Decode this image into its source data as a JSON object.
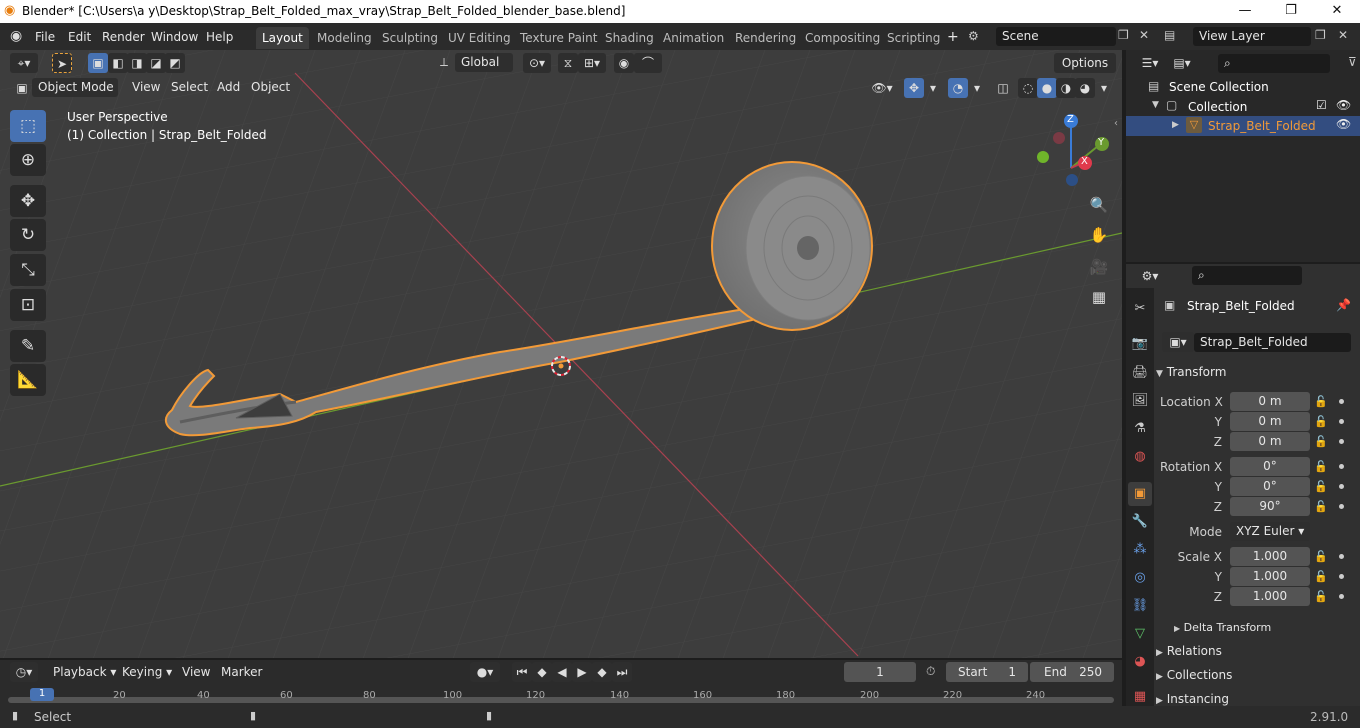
{
  "titlebar": {
    "title": "Blender* [C:\\Users\\a y\\Desktop\\Strap_Belt_Folded_max_vray\\Strap_Belt_Folded_blender_base.blend]",
    "minimize": "—",
    "maximize": "❐",
    "close": "✕"
  },
  "menu": {
    "file": "File",
    "edit": "Edit",
    "render": "Render",
    "window": "Window",
    "help": "Help"
  },
  "workspaces": [
    "Layout",
    "Modeling",
    "Sculpting",
    "UV Editing",
    "Texture Paint",
    "Shading",
    "Animation",
    "Rendering",
    "Compositing",
    "Scripting"
  ],
  "scene": {
    "name": "Scene",
    "view_layer": "View Layer"
  },
  "viewport_header": {
    "transform_orientation": "Global",
    "options": "Options",
    "mode": "Object Mode",
    "menus": [
      "View",
      "Select",
      "Add",
      "Object"
    ]
  },
  "viewport": {
    "perspective": "User Perspective",
    "collection_info": "(1) Collection | Strap_Belt_Folded",
    "gizmo": {
      "x": "X",
      "y": "Y",
      "z": "Z"
    }
  },
  "outliner": {
    "scene_collection": "Scene Collection",
    "collection": "Collection",
    "object": "Strap_Belt_Folded"
  },
  "properties": {
    "object_name": "Strap_Belt_Folded",
    "data_name": "Strap_Belt_Folded",
    "transform_title": "Transform",
    "location": {
      "label_x": "Location X",
      "label_y": "Y",
      "label_z": "Z",
      "x": "0 m",
      "y": "0 m",
      "z": "0 m"
    },
    "rotation": {
      "label_x": "Rotation X",
      "label_y": "Y",
      "label_z": "Z",
      "x": "0°",
      "y": "0°",
      "z": "90°"
    },
    "mode_label": "Mode",
    "mode_value": "XYZ Euler",
    "scale": {
      "label_x": "Scale X",
      "label_y": "Y",
      "label_z": "Z",
      "x": "1.000",
      "y": "1.000",
      "z": "1.000"
    },
    "delta_transform": "Delta Transform",
    "relations": "Relations",
    "collections": "Collections",
    "instancing": "Instancing"
  },
  "timeline": {
    "menus": [
      "Playback",
      "Keying",
      "View",
      "Marker"
    ],
    "current_frame": "1",
    "start_label": "Start",
    "start": "1",
    "end_label": "End",
    "end": "250",
    "ticks": [
      "1",
      "20",
      "40",
      "60",
      "80",
      "100",
      "120",
      "140",
      "160",
      "180",
      "200",
      "220",
      "240"
    ]
  },
  "status": {
    "select": "Select",
    "version": "2.91.0"
  },
  "colors": {
    "accent": "#4772b3",
    "selection_outline": "#f29a38",
    "x_axis": "#a8414f",
    "y_axis": "#6a9a2f"
  }
}
